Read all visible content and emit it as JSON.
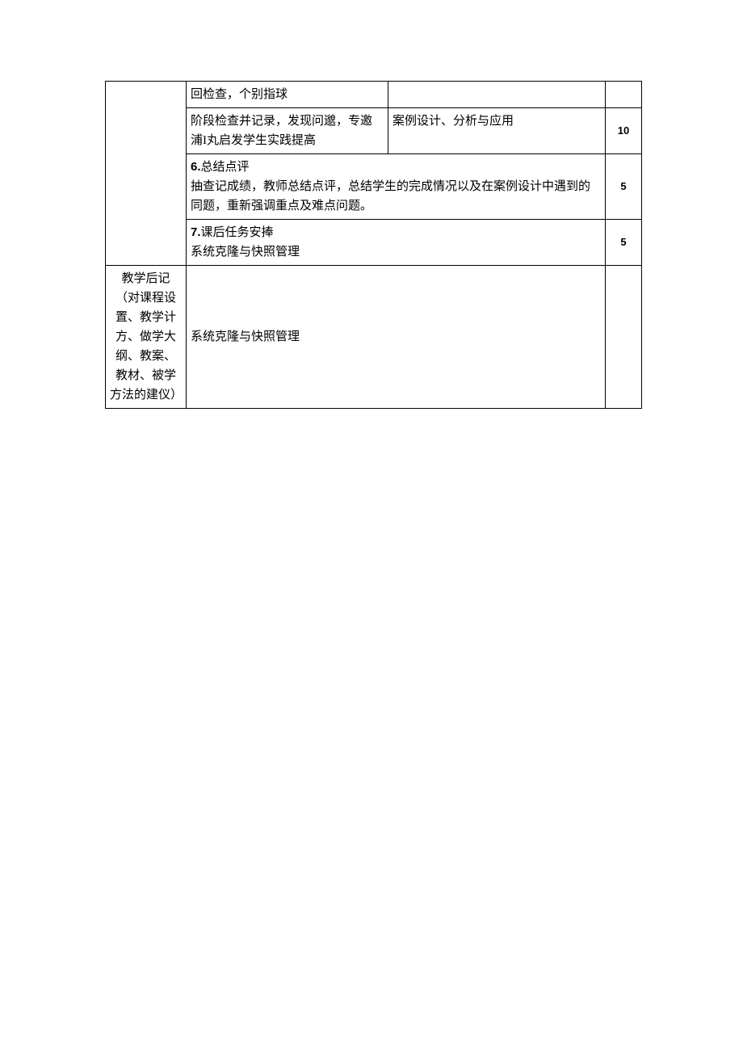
{
  "rows": {
    "r1": {
      "left": "回检查，个别指球"
    },
    "r2": {
      "left": "阶段检查并记录，发现问邈，专邀浦I丸启发学生实践提高",
      "mid": "案例设计、分析与应用",
      "right": "10"
    },
    "r3": {
      "num": "6.",
      "title": "总结点评",
      "body": "抽查记成绩，教师总结点评，总结学生的完成情况以及在案例设计中遇到的同题，重新强调重点及难点问题。",
      "right": "5"
    },
    "r4": {
      "num": "7.",
      "title": "课后任务安捧",
      "body": "系统克隆与快照管理",
      "right": "5"
    },
    "r5": {
      "label": "教学后记（对课程设置、教学计方、做学大纲、教案、教材、被学方法的建仪）",
      "body": "系统克隆与快照管理"
    }
  }
}
